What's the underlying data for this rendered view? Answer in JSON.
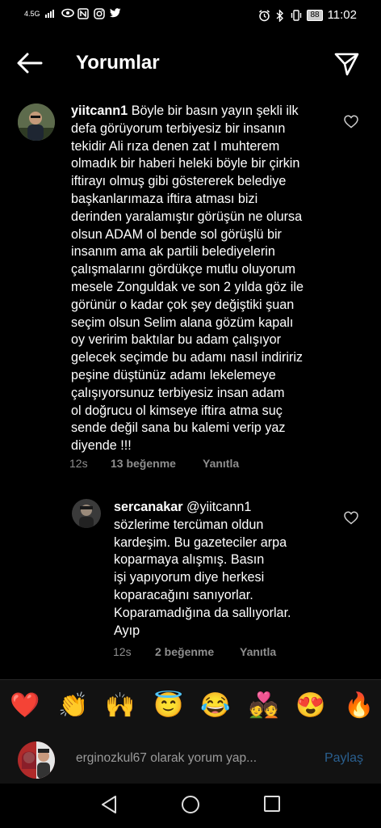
{
  "status_bar": {
    "network": "4.5G",
    "time": "11:02",
    "battery": "88"
  },
  "header": {
    "title": "Yorumlar"
  },
  "comments": [
    {
      "username": "yiitcann1",
      "lines": [
        "Böyle bir basın yayın şekli ilk",
        "defa görüyorum terbiyesiz bir insanın",
        "tekidir Ali rıza denen zat I muhterem",
        "olmadık bir haberi heleki böyle bir çirkin",
        "iftirayı olmuş gibi göstererek belediye",
        "başkanlarımaza iftira atması bizi",
        "derinden yaralamıştır görüşün ne olursa",
        "olsun ADAM ol bende sol görüşlü bir",
        "insanım ama ak partili belediyelerin",
        "çalışmalarını gördükçe mutlu oluyorum",
        "mesele Zonguldak ve son 2 yılda göz ile",
        "görünür o kadar çok şey değiştiki şuan",
        "seçim olsun Selim alana gözüm kapalı",
        "oy veririm baktılar bu adam çalışıyor",
        "gelecek seçimde bu adamı nasıl indiririz",
        "peşine düştünüz adamı lekelemeye",
        "çalışıyorsunuz terbiyesiz insan adam",
        "ol doğrucu ol kimseye iftira atma suç",
        "sende değil sana bu kalemi verip yaz",
        "diyende !!!"
      ],
      "time": "12s",
      "likes": "13 beğenme",
      "reply": "Yanıtla"
    },
    {
      "username": "sercanakar",
      "mention": "@yiitcann1",
      "lines": [
        "sözlerime tercüman oldun",
        "kardeşim. Bu gazeteciler arpa",
        "koparmaya alışmış. Basın",
        "işi yapıyorum diye herkesi",
        "koparacağını sanıyorlar.",
        "Koparamadığına da sallıyorlar.",
        "Ayıp"
      ],
      "time": "12s",
      "likes": "2 beğenme",
      "reply": "Yanıtla"
    }
  ],
  "emojis": [
    "❤️",
    "👏",
    "🙌",
    "😇",
    "😂",
    "💑",
    "😍",
    "🔥"
  ],
  "composer": {
    "placeholder": "erginozkul67 olarak yorum yap...",
    "share": "Paylaş"
  }
}
